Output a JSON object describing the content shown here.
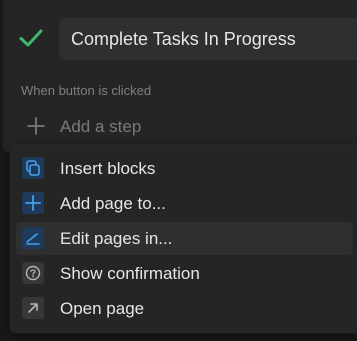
{
  "button": {
    "title": "Complete Tasks In Progress",
    "check_icon": "check-icon"
  },
  "steps": {
    "section_label": "When button is clicked",
    "add_step_label": "Add a step",
    "add_step_icon": "plus-icon"
  },
  "menu": {
    "items": [
      {
        "label": "Insert blocks",
        "icon": "copy-blocks-icon",
        "icon_color": "#4a9fe8"
      },
      {
        "label": "Add page to...",
        "icon": "plus-icon",
        "icon_color": "#4a9fe8"
      },
      {
        "label": "Edit pages in...",
        "icon": "pencil-icon",
        "icon_color": "#4a9fe8"
      },
      {
        "label": "Show confirmation",
        "icon": "question-circle-icon",
        "icon_color": "#b5b5b5"
      },
      {
        "label": "Open page",
        "icon": "arrow-up-right-icon",
        "icon_color": "#b5b5b5"
      }
    ]
  },
  "colors": {
    "accent_green": "#3fb86c",
    "accent_blue": "#4a9fe8",
    "background": "#191919",
    "panel": "#252525"
  }
}
